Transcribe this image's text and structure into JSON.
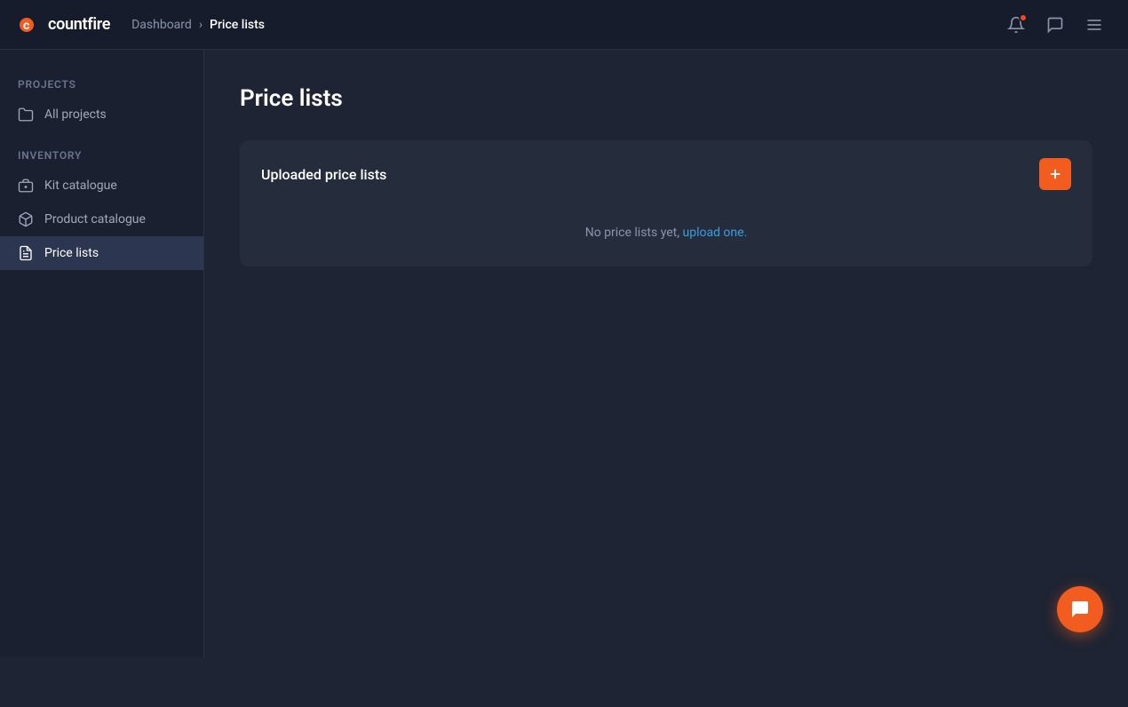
{
  "brand": {
    "logo_letter": "⬤",
    "name": "countfire"
  },
  "topnav": {
    "breadcrumb_parent": "Dashboard",
    "breadcrumb_current": "Price lists",
    "icons": {
      "notifications": "bell",
      "messages": "message-square",
      "menu": "menu"
    }
  },
  "sidebar": {
    "projects_label": "Projects",
    "all_projects_label": "All projects",
    "inventory_label": "Inventory",
    "nav_items": [
      {
        "id": "kit-catalogue",
        "label": "Kit catalogue",
        "icon": "kit"
      },
      {
        "id": "product-catalogue",
        "label": "Product catalogue",
        "icon": "box"
      },
      {
        "id": "price-lists",
        "label": "Price lists",
        "icon": "list",
        "active": true
      }
    ]
  },
  "main": {
    "page_title": "Price lists",
    "card": {
      "title": "Uploaded price lists",
      "add_button_label": "+",
      "empty_text": "No price lists yet, ",
      "upload_link_text": "upload one."
    }
  },
  "chat": {
    "icon": "chat"
  }
}
